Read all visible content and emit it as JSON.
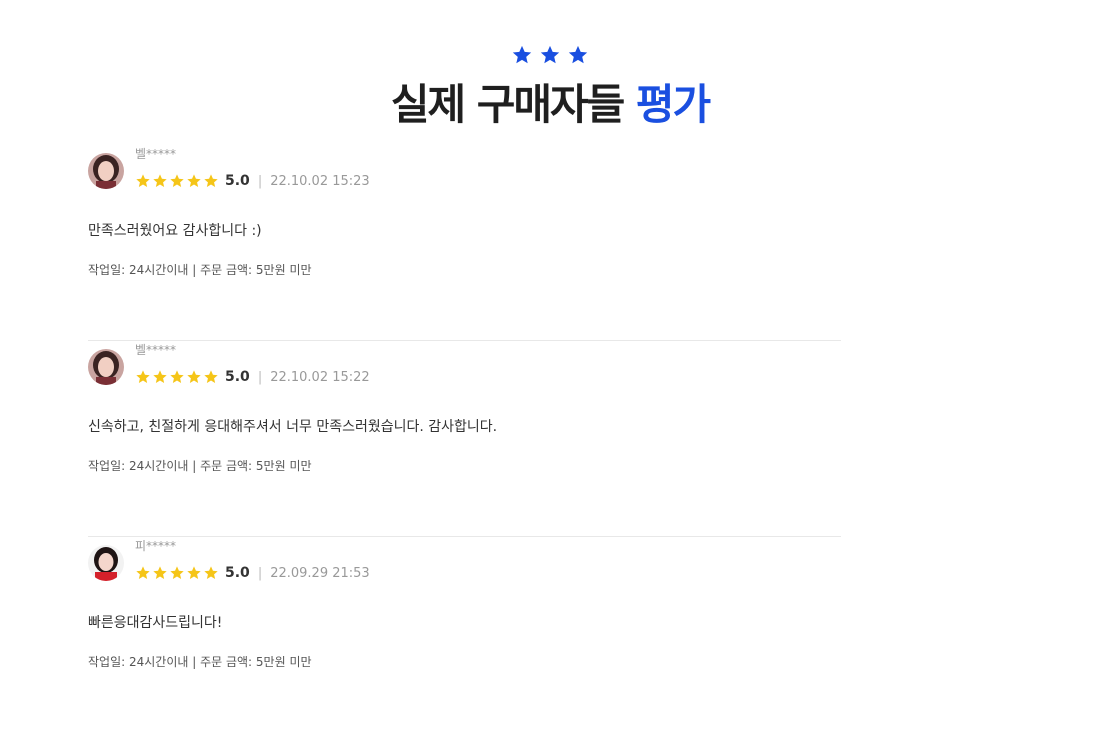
{
  "header": {
    "star_count": 3,
    "star_color": "#1a4fe0",
    "title_main": "실제 구매자들",
    "title_accent": "평가",
    "accent_color": "#1a4fe0"
  },
  "rating_star_color": "#f5c518",
  "reviews": [
    {
      "reviewer": "벨*****",
      "stars": 5,
      "score": "5.0",
      "separator": "|",
      "date": "22.10.02 15:23",
      "comment": "만족스러웠어요 감사합니다 :)",
      "meta": "작업일: 24시간이내 | 주문 금액: 5만원 미만",
      "avatar_icon": "avatar-woman-dark-hair"
    },
    {
      "reviewer": "벨*****",
      "stars": 5,
      "score": "5.0",
      "separator": "|",
      "date": "22.10.02 15:22",
      "comment": "신속하고, 친절하게 응대해주셔서 너무 만족스러웠습니다. 감사합니다.",
      "meta": "작업일: 24시간이내 | 주문 금액: 5만원 미만",
      "avatar_icon": "avatar-woman-dark-hair"
    },
    {
      "reviewer": "피*****",
      "stars": 5,
      "score": "5.0",
      "separator": "|",
      "date": "22.09.29 21:53",
      "comment": "빠른응대감사드립니다!",
      "meta": "작업일: 24시간이내 | 주문 금액: 5만원 미만",
      "avatar_icon": "avatar-woman-red-top"
    }
  ]
}
